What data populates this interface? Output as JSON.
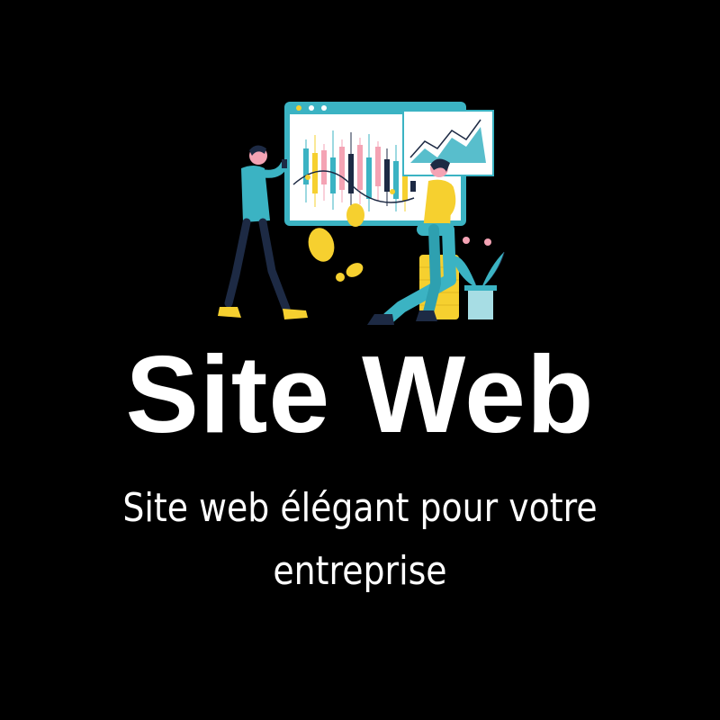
{
  "hero": {
    "title": "Site Web",
    "subtitle": "Site web élégant pour votre entreprise"
  },
  "colors": {
    "background": "#000000",
    "text": "#ffffff",
    "teal": "#3bb3c3",
    "yellow": "#f6d02f",
    "pink": "#f4a3b4",
    "navy": "#1d2a44"
  },
  "illustration": {
    "icon": "business-people-chart-illustration"
  }
}
